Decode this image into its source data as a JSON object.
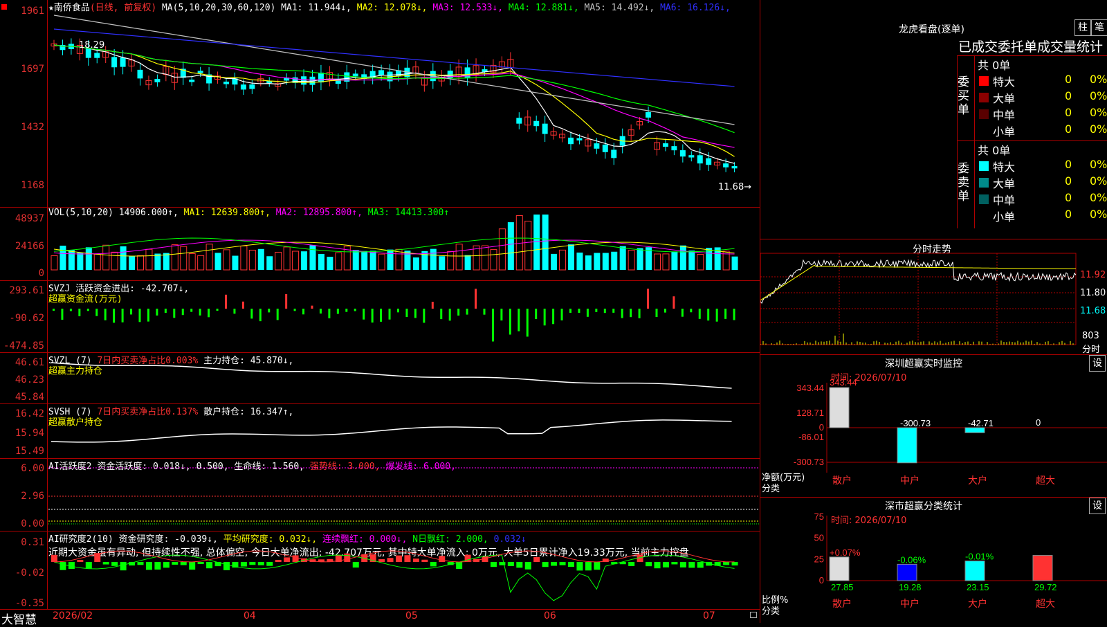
{
  "stock_header": {
    "star": "★",
    "name": "南侨食品",
    "period": "(日线, 前复权)",
    "ma_label": "MA(5,10,20,30,60,120)",
    "ma_items": [
      {
        "label": "MA1:",
        "value": "11.944↓",
        "color": "#ffffff"
      },
      {
        "label": "MA2:",
        "value": "12.078↓",
        "color": "#ffff00"
      },
      {
        "label": "MA3:",
        "value": "12.533↓",
        "color": "#ff00ff"
      },
      {
        "label": "MA4:",
        "value": "12.881↓",
        "color": "#00ff00"
      },
      {
        "label": "MA5:",
        "value": "14.492↓",
        "color": "#c0c0c0"
      },
      {
        "label": "MA6:",
        "value": "16.126↓",
        "color": "#3030ff"
      }
    ]
  },
  "price_pane": {
    "y_labels": [
      "1961",
      "1697",
      "1432",
      "1168"
    ],
    "high_label": "18.29",
    "last_label": "11.68→"
  },
  "vol_pane": {
    "y_labels": [
      "48937",
      "24166",
      "0"
    ],
    "label": "VOL(5,10,20)",
    "value": "14906.000↑,",
    "ma1": "MA1: 12639.800↑,",
    "ma2": "MA2: 12895.800↑,",
    "ma3": "MA3: 14413.300↑"
  },
  "svzj_pane": {
    "y_labels": [
      "293.61",
      "-90.62",
      "-474.85"
    ],
    "line1": "SVZJ  活跃资金进出: -42.707↓,",
    "line2": "超赢资金流(万元)"
  },
  "svzl_pane": {
    "y_labels": [
      "46.61",
      "46.23",
      "45.84"
    ],
    "label": "SVZL (7)",
    "ratio": "7日内买卖净占比0.003%",
    "hold": "主力持仓: 45.870↓,",
    "line2": "超赢主力持仓"
  },
  "svsh_pane": {
    "y_labels": [
      "16.42",
      "15.94",
      "15.49"
    ],
    "label": "SVSH (7)",
    "ratio": "7日内买卖净占比0.137%",
    "hold": "散户持仓: 16.347↑,",
    "line2": "超赢散户持仓"
  },
  "ai_active_pane": {
    "y_labels": [
      "6.00",
      "2.96",
      "0.00"
    ],
    "label": "AI活跃度2",
    "v1": "资金活跃度: 0.018↓,",
    "v2": "0.500,",
    "v3": "生命线: 1.560,",
    "v4": "强势线: 3.000,",
    "v5": "爆发线: 6.000,"
  },
  "ai_research_pane": {
    "y_labels": [
      "0.31",
      "-0.02",
      "-0.35"
    ],
    "label": "AI研究度2(10)",
    "v1": "资金研究度: -0.039↓,",
    "v2": "平均研究度: 0.032↓,",
    "v3": "连续飘红: 0.000↓,",
    "v4": "N日飘红: 2.000,",
    "v5": "0.032↓",
    "comment": "近期大资金虽有异动, 但持续性不强, 总体偏空, 今日大单净流出: -42.707万元, 其中特大单净流入: 0万元, 大单5日累计净入19.33万元, 当前主力控盘"
  },
  "x_axis": {
    "labels": [
      "2026/02",
      "04",
      "05",
      "06",
      "07"
    ],
    "brand": "大智慧"
  },
  "dragon_tiger": {
    "title": "龙虎看盘(逐单)",
    "btn_bar": "柱",
    "btn_list": "笔",
    "subtitle": "已成交委托单成交量统计",
    "buy_side": "委买单",
    "sell_side": "委卖单",
    "buy_total": "共 0单",
    "sell_total": "共 0单",
    "buy_rows": [
      {
        "name": "特大",
        "count": "0",
        "pct": "0%",
        "color": "#ff0000"
      },
      {
        "name": "大单",
        "count": "0",
        "pct": "0%",
        "color": "#8b0000"
      },
      {
        "name": "中单",
        "count": "0",
        "pct": "0%",
        "color": "#5a0000"
      },
      {
        "name": "小单",
        "count": "0",
        "pct": "0%",
        "color": "#000000"
      }
    ],
    "sell_rows": [
      {
        "name": "特大",
        "count": "0",
        "pct": "0%",
        "color": "#00ffff"
      },
      {
        "name": "大单",
        "count": "0",
        "pct": "0%",
        "color": "#008b8b"
      },
      {
        "name": "中单",
        "count": "0",
        "pct": "0%",
        "color": "#006060"
      },
      {
        "name": "小单",
        "count": "0",
        "pct": "0%",
        "color": "#000000"
      }
    ]
  },
  "intraday": {
    "title": "分时走势",
    "price_labels": [
      "11.92",
      "11.80",
      "11.68"
    ],
    "vol_label": "803",
    "vol_unit": "分时"
  },
  "sz_monitor": {
    "title": "深圳超赢实时监控",
    "settings": "设",
    "time": "时间: 2026/07/10",
    "y_labels": [
      "343.44",
      "128.71",
      "0",
      "-86.01",
      "-300.73"
    ],
    "y_title": "净额(万元)",
    "x_title": "分类",
    "bars": [
      {
        "name": "散户",
        "value": 343.44,
        "label": "343.44"
      },
      {
        "name": "中户",
        "value": -300.73,
        "label": "-300.73"
      },
      {
        "name": "大户",
        "value": -42.71,
        "label": "-42.71"
      },
      {
        "name": "超大",
        "value": 0,
        "label": "0"
      }
    ]
  },
  "sz_classify": {
    "title": "深市超赢分类统计",
    "settings": "设",
    "time": "时间: 2026/07/10",
    "y_labels": [
      "75",
      "50",
      "25",
      "0"
    ],
    "y_title": "比例%",
    "x_title": "分类",
    "bars": [
      {
        "name": "散户",
        "value": 27.85,
        "label": "27.85",
        "change": "+0.07%"
      },
      {
        "name": "中户",
        "value": 19.28,
        "label": "19.28",
        "change": "-0.06%"
      },
      {
        "name": "大户",
        "value": 23.15,
        "label": "23.15",
        "change": "-0.01%"
      },
      {
        "name": "超大",
        "value": 29.72,
        "label": "29.72",
        "change": ""
      }
    ]
  },
  "colors": {
    "up": "#ff3232",
    "down": "#00ffff",
    "axis": "#b00000",
    "green": "#00ff00"
  }
}
